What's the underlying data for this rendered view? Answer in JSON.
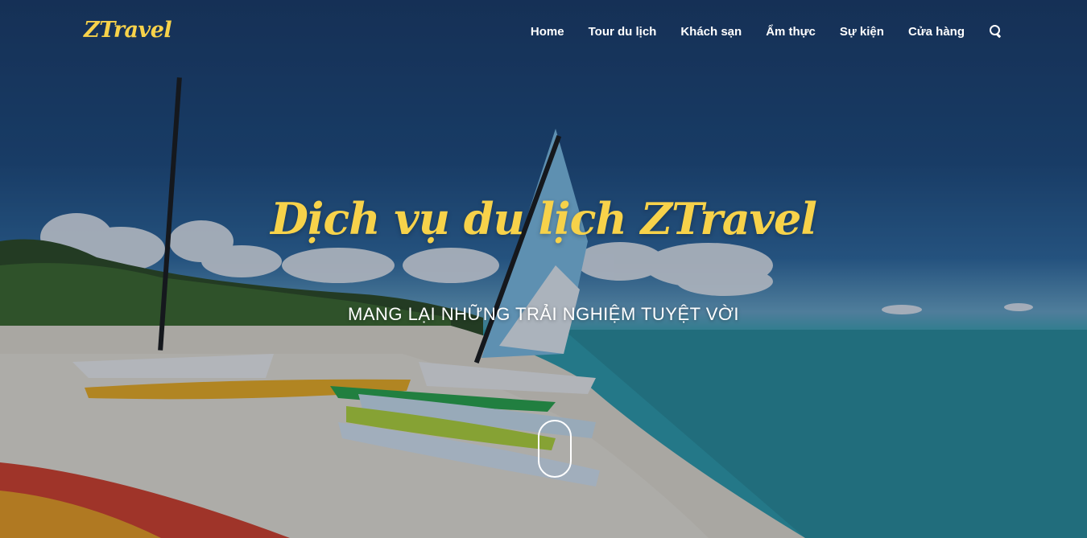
{
  "header": {
    "logo": "ZTravel",
    "nav": [
      {
        "label": "Home"
      },
      {
        "label": "Tour du lịch"
      },
      {
        "label": "Khách sạn"
      },
      {
        "label": "Ẩm thực"
      },
      {
        "label": "Sự kiện"
      },
      {
        "label": "Cửa hàng"
      }
    ],
    "search_icon": "search-icon"
  },
  "hero": {
    "title": "Dịch vụ du lịch ZTravel",
    "subtitle": "MANG LẠI NHỮNG TRẢI NGHIỆM TUYỆT VỜI",
    "scroll_icon": "mouse-scroll-icon"
  },
  "colors": {
    "accent": "#f7d24a",
    "nav_text": "#ffffff",
    "sky": "#1e4b7e",
    "sea": "#2c9aa6",
    "sand": "#e8e2d8"
  }
}
